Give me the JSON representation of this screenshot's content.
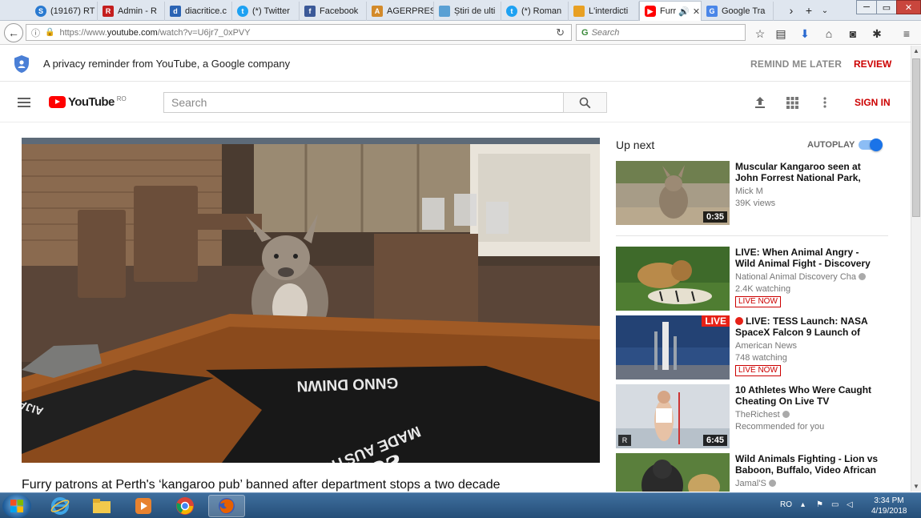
{
  "browser": {
    "tabs": [
      {
        "label": "(19167) RT",
        "favicon": "skype-icon",
        "color": "#2a7ad0",
        "active": false
      },
      {
        "label": "Admin - R",
        "favicon": "r-logo-icon",
        "color": "#c41e1e",
        "active": false
      },
      {
        "label": "diacritice.c",
        "favicon": "d-logo-icon",
        "color": "#2b64b4",
        "active": false
      },
      {
        "label": "(*) Twitter",
        "favicon": "twitter-icon",
        "color": "#1da1f2",
        "active": false
      },
      {
        "label": "Facebook",
        "favicon": "facebook-icon",
        "color": "#3b5998",
        "active": false
      },
      {
        "label": "AGERPRES",
        "favicon": "agerpres-icon",
        "color": "#d38a2a",
        "active": false
      },
      {
        "label": "Știri de ulti",
        "favicon": "news-icon",
        "color": "#5aa0d4",
        "active": false
      },
      {
        "label": "(*) Roman",
        "favicon": "twitter-icon",
        "color": "#1da1f2",
        "active": false
      },
      {
        "label": "L'interdicti",
        "favicon": "flag-icon",
        "color": "#e8a023",
        "active": false
      },
      {
        "label": "Furr",
        "favicon": "youtube-icon",
        "color": "#ff0000",
        "active": true
      },
      {
        "label": "Google Tra",
        "favicon": "google-translate-icon",
        "color": "#4a86e8",
        "active": false
      }
    ],
    "url_prefix": "https://www.",
    "url_host": "youtube.com",
    "url_path": "/watch?v=U6jr7_0xPVY",
    "search_placeholder": "Search"
  },
  "privacy": {
    "message": "A privacy reminder from YouTube, a Google company",
    "remind_later": "REMIND ME LATER",
    "review": "REVIEW"
  },
  "masthead": {
    "logo_text": "YouTube",
    "country_code": "RO",
    "search_placeholder": "Search",
    "sign_in": "SIGN IN"
  },
  "video": {
    "title": "Furry patrons at Perth's ‘kangaroo pub’ banned after department stops a two decade"
  },
  "sidebar": {
    "up_next": "Up next",
    "autoplay_label": "AUTOPLAY",
    "autoplay_on": true,
    "items": [
      {
        "title": "Muscular Kangaroo seen at John Forrest National Park,",
        "channel": "Mick M",
        "meta": "39K views",
        "duration": "0:35",
        "badge": "",
        "verified": false,
        "live": false
      },
      {
        "title": "LIVE: When Animal Angry - Wild Animal Fight - Discovery Wild",
        "channel": "National Animal Discovery Cha",
        "meta": "2.4K watching",
        "duration": "",
        "badge": "LIVE NOW",
        "verified": true,
        "live": false
      },
      {
        "title": "LIVE: TESS Launch: NASA SpaceX Falcon 9 Launch of",
        "channel": "American News",
        "meta": "748 watching",
        "duration": "",
        "badge": "LIVE NOW",
        "verified": false,
        "live": true,
        "thumb_label": "LIVE"
      },
      {
        "title": "10 Athletes Who Were Caught Cheating On Live TV",
        "channel": "TheRichest",
        "meta": "Recommended for you",
        "duration": "6:45",
        "badge": "",
        "verified": true,
        "live": false
      },
      {
        "title": "Wild Animals Fighting - Lion vs Baboon, Buffalo, Video African",
        "channel": "Jamal'S",
        "meta": "",
        "duration": "",
        "badge": "",
        "verified": true,
        "live": false
      }
    ]
  },
  "taskbar": {
    "language": "RO",
    "time": "3:34 PM",
    "date": "4/19/2018"
  }
}
